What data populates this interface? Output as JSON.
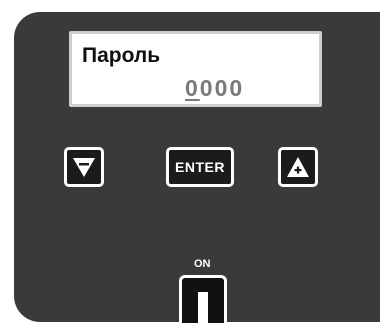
{
  "display": {
    "label": "Пароль",
    "value_cursor": "0",
    "value_rest": "000"
  },
  "keys": {
    "down_icon": "minus-down-triangle-icon",
    "enter_label": "ENTER",
    "up_icon": "plus-up-triangle-icon"
  },
  "power": {
    "label": "ON",
    "icon": "power-bar-icon"
  },
  "colors": {
    "panel": "#3a3a3a",
    "key_border": "#ffffff",
    "display_bg": "#ffffff",
    "display_value": "#7a7a7a"
  }
}
